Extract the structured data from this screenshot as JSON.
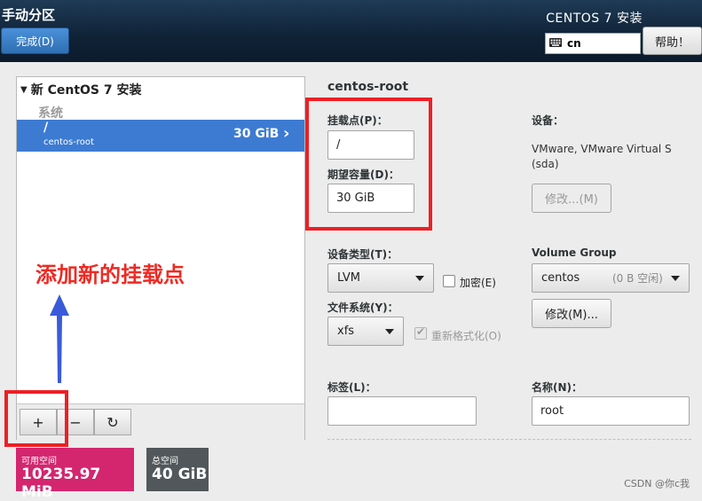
{
  "header": {
    "title": "手动分区",
    "done_label": "完成(D)",
    "app_title": "CENTOS 7 安装",
    "keyboard_layout": "cn",
    "help_label": "帮助！"
  },
  "left_panel": {
    "install_title": "新 CentOS 7 安装",
    "group_label": "系统",
    "mount_point": "/",
    "device_name": "centos-root",
    "size": "30 GiB"
  },
  "toolbar": {
    "add": "+",
    "remove": "−",
    "refresh": "↻"
  },
  "space": {
    "available_label": "可用空间",
    "available_value": "10235.97 MiB",
    "total_label": "总空间",
    "total_value": "40 GiB"
  },
  "annotation": "添加新的挂载点",
  "detail": {
    "heading": "centos-root",
    "mount_label": "挂载点(P)：",
    "mount_value": "/",
    "capacity_label": "期望容量(D)：",
    "capacity_value": "30 GiB",
    "device_label": "设备：",
    "device_value": "VMware, VMware Virtual S (sda)",
    "modify_device_label": "修改...(M)",
    "device_type_label": "设备类型(T)：",
    "device_type_value": "LVM",
    "encrypt_label": "加密(E)",
    "fs_label": "文件系统(Y)：",
    "fs_value": "xfs",
    "reformat_label": "重新格式化(O)",
    "vg_label": "Volume Group",
    "vg_value": "centos",
    "vg_free": "(0 B 空闲)",
    "vg_modify_label": "修改(M)...",
    "tag_label": "标签(L)：",
    "tag_value": "",
    "name_label": "名称(N)：",
    "name_value": "root"
  },
  "watermark": "CSDN @你c我",
  "colors": {
    "selected_row": "#3d7bd3",
    "available": "#d3266f",
    "total": "#51575a",
    "annotation": "#ee1f25"
  }
}
